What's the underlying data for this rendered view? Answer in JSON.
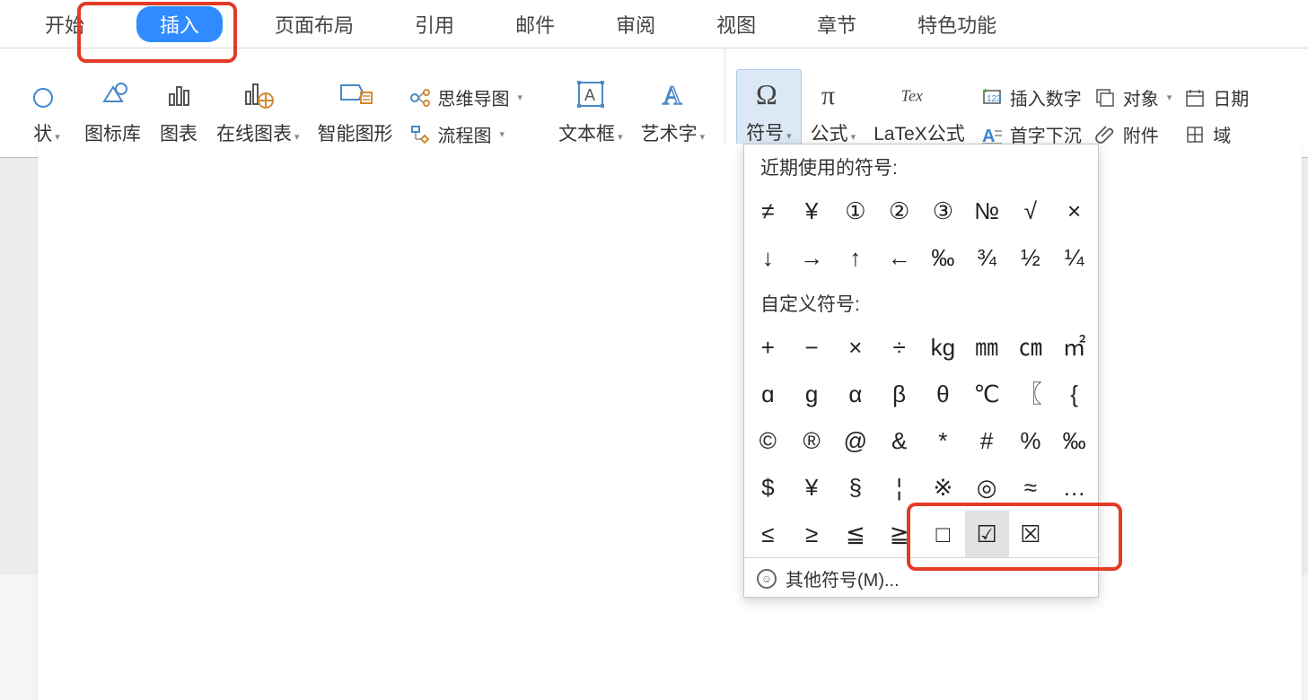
{
  "tabs": [
    "开始",
    "插入",
    "页面布局",
    "引用",
    "邮件",
    "审阅",
    "视图",
    "章节",
    "特色功能"
  ],
  "active_tab_index": 1,
  "ribbon": {
    "shapes_dd": "状",
    "icon_library": "图标库",
    "chart": "图表",
    "online_chart": "在线图表",
    "smart_art": "智能图形",
    "mindmap": "思维导图",
    "flowchart": "流程图",
    "textbox": "文本框",
    "wordart": "艺术字",
    "symbol": "符号",
    "formula": "公式",
    "latex": "LaTeX公式",
    "insert_number": "插入数字",
    "drop_cap": "首字下沉",
    "object": "对象",
    "attachment": "附件",
    "date": "日期",
    "field": "域"
  },
  "symbol_panel": {
    "recent_header": "近期使用的符号:",
    "recent": [
      "≠",
      "¥",
      "①",
      "②",
      "③",
      "№",
      "√",
      "×",
      "↓",
      "→",
      "↑",
      "←",
      "‰",
      "¾",
      "½",
      "¼"
    ],
    "custom_header": "自定义符号:",
    "custom": [
      "+",
      "−",
      "×",
      "÷",
      "kg",
      "㎜",
      "㎝",
      "㎡",
      "ɑ",
      "ɡ",
      "α",
      "β",
      "θ",
      "℃",
      "〖",
      "{",
      "©",
      "®",
      "@",
      "&",
      "*",
      "#",
      "%",
      "‰",
      "$",
      "¥",
      "§",
      "¦",
      "※",
      "◎",
      "≈",
      "…",
      "≤",
      "≥",
      "≦",
      "≧",
      "□",
      "☑",
      "☒",
      ""
    ],
    "hovered_custom_index": 37,
    "more_label": "其他符号(M)..."
  },
  "colors": {
    "accent": "#2f8bff",
    "highlight": "#e33b25"
  }
}
